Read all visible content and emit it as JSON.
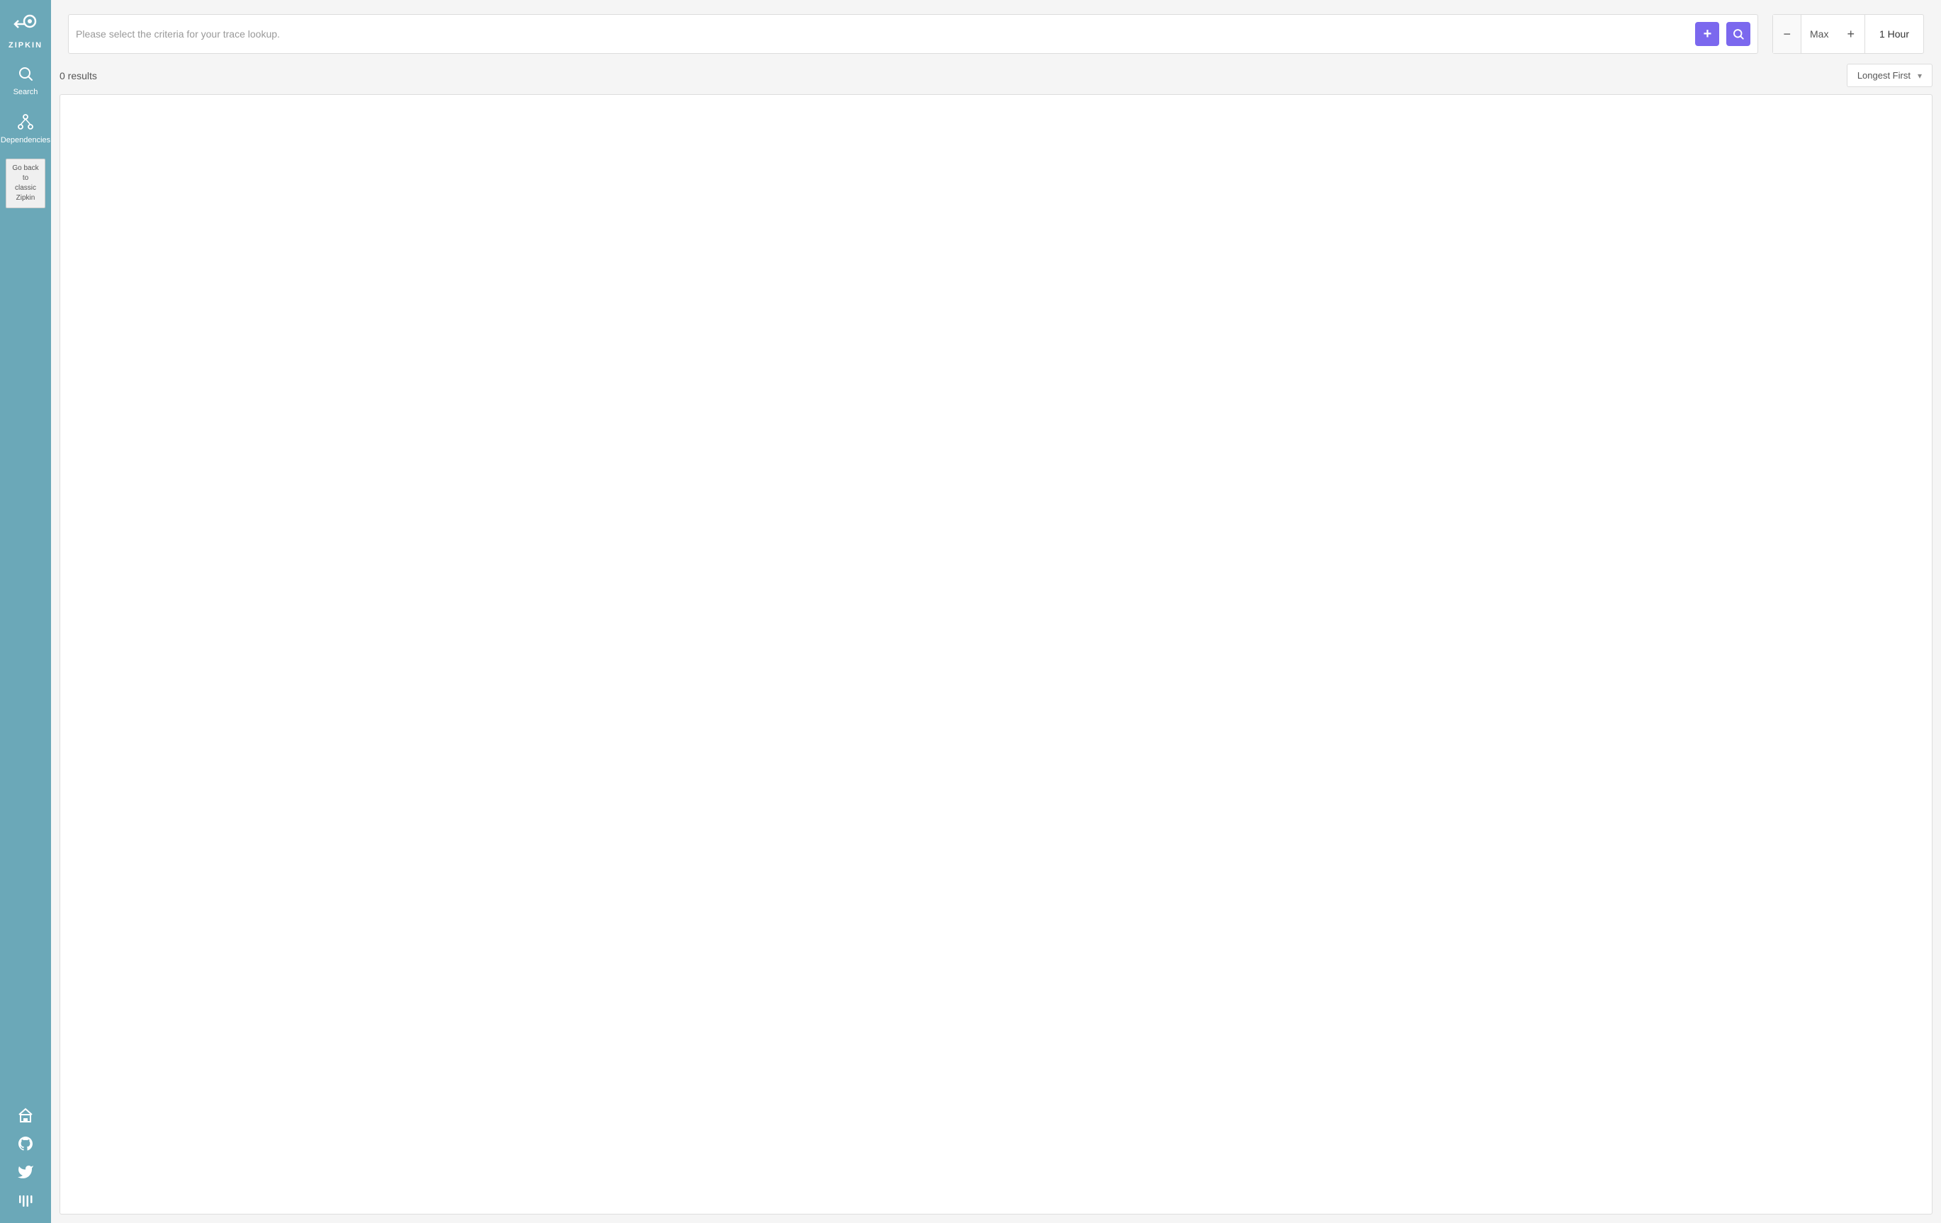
{
  "sidebar": {
    "logo_text": "ZIPKIN",
    "nav_items": [
      {
        "id": "search",
        "label": "Search",
        "icon": "🔍"
      },
      {
        "id": "dependencies",
        "label": "Dependencies",
        "icon": "⑂"
      }
    ],
    "go_back_label": "Go back\nto\nclassic\nZipkin",
    "bottom_icons": [
      {
        "id": "home",
        "icon": "⌂"
      },
      {
        "id": "github",
        "icon": "🐙"
      },
      {
        "id": "twitter",
        "icon": "🐦"
      },
      {
        "id": "gitter",
        "icon": "≡"
      }
    ]
  },
  "search_bar": {
    "placeholder": "Please select the criteria for your trace lookup.",
    "add_button_label": "+",
    "search_button_label": "🔍"
  },
  "time_control": {
    "minus_label": "−",
    "max_label": "Max",
    "plus_label": "+",
    "value": "1 Hour"
  },
  "results": {
    "count": "0 results",
    "sort_label": "Longest First"
  }
}
